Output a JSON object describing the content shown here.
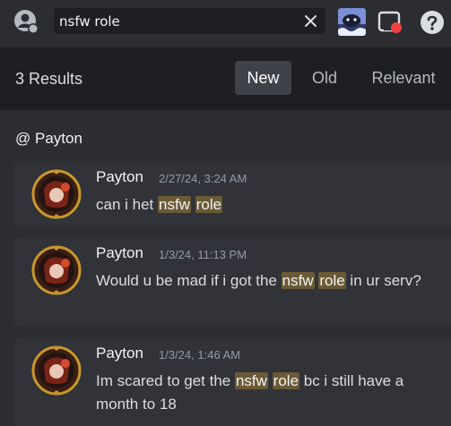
{
  "search": {
    "query": "nsfw role"
  },
  "results": {
    "count_label": "3 Results",
    "sort_tabs": [
      "New",
      "Old",
      "Relevant"
    ],
    "active_tab": "New",
    "channel_label": "@ Payton"
  },
  "messages": [
    {
      "author": "Payton",
      "timestamp": "2/27/24, 3:24 AM",
      "parts": [
        "can i het ",
        "nsfw",
        " ",
        "role",
        ""
      ]
    },
    {
      "author": "Payton",
      "timestamp": "1/3/24, 11:13 PM",
      "parts": [
        "Would u be mad if i got the ",
        "nsfw",
        " ",
        "role",
        " in ur serv?"
      ]
    },
    {
      "author": "Payton",
      "timestamp": "1/3/24, 1:46 AM",
      "parts": [
        "Im scared to get the ",
        "nsfw",
        " ",
        "role",
        " bc i still have a month to 18"
      ]
    }
  ],
  "colors": {
    "background": "#2b2d31",
    "header": "#1e1f22",
    "card": "#313338",
    "highlight": "#6b5a36",
    "active_tab": "#404249"
  },
  "icons": [
    "mention-icon",
    "close-icon",
    "game-thumbnail",
    "inbox-icon",
    "help-icon",
    "avatar"
  ]
}
